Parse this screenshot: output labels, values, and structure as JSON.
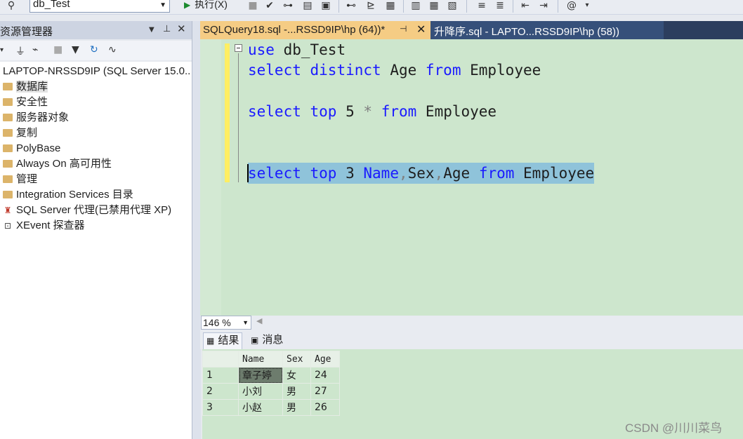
{
  "toolbar": {
    "database": "db_Test",
    "execute_label": "执行(X)"
  },
  "object_explorer": {
    "title": "资源管理器",
    "server": "LAPTOP-NRSSD9IP (SQL Server 15.0..",
    "nodes": [
      {
        "label": "数据库",
        "icon": "folder-icon"
      },
      {
        "label": "安全性",
        "icon": "folder-icon"
      },
      {
        "label": "服务器对象",
        "icon": "folder-icon"
      },
      {
        "label": "复制",
        "icon": "folder-icon"
      },
      {
        "label": "PolyBase",
        "icon": "folder-icon"
      },
      {
        "label": "Always On 高可用性",
        "icon": "folder-icon"
      },
      {
        "label": "管理",
        "icon": "folder-icon"
      },
      {
        "label": "Integration Services 目录",
        "icon": "folder-icon"
      },
      {
        "label": "SQL Server 代理(已禁用代理 XP)",
        "icon": "agent-icon"
      },
      {
        "label": "XEvent 探查器",
        "icon": "xevent-icon"
      }
    ]
  },
  "tabs": [
    {
      "label": "SQLQuery18.sql -...RSSD9IP\\hp (64))*",
      "active": true
    },
    {
      "label": "升降序.sql - LAPTO...RSSD9IP\\hp (58))",
      "active": false
    }
  ],
  "editor": {
    "line1": {
      "kw": "use",
      "rest": " db_Test"
    },
    "line2": {
      "kw1": "select",
      "kw2": "distinct",
      "mid": " Age ",
      "kw3": "from",
      "rest": " Employee"
    },
    "line3": {
      "kw1": "select",
      "kw2": "top",
      "mid": " 5 ",
      "star": "*",
      "kw3": "from",
      "rest": " Employee"
    },
    "line4": {
      "kw1": "select",
      "kw2": "top",
      "num": " 3 ",
      "col1": "Name",
      "comma1": ",",
      "col2": "Sex",
      "comma2": ",",
      "col3": "Age",
      "kw3": "from",
      "rest": " Employee"
    }
  },
  "zoom": "146 %",
  "results_tabs": {
    "results": "结果",
    "messages": "消息"
  },
  "results": {
    "columns": [
      "Name",
      "Sex",
      "Age"
    ],
    "rows": [
      {
        "n": "1",
        "name": "章子婷",
        "sex": "女",
        "age": "24"
      },
      {
        "n": "2",
        "name": "小刘",
        "sex": "男",
        "age": "27"
      },
      {
        "n": "3",
        "name": "小赵",
        "sex": "男",
        "age": "26"
      }
    ]
  },
  "watermark": "CSDN @川川菜鸟",
  "colors": {
    "keyword": "#1a1aff",
    "editor_bg": "#cde6cd",
    "active_tab": "#f5cc84",
    "tab_strip": "#2c3e5e",
    "selection": "#8fc3da"
  }
}
